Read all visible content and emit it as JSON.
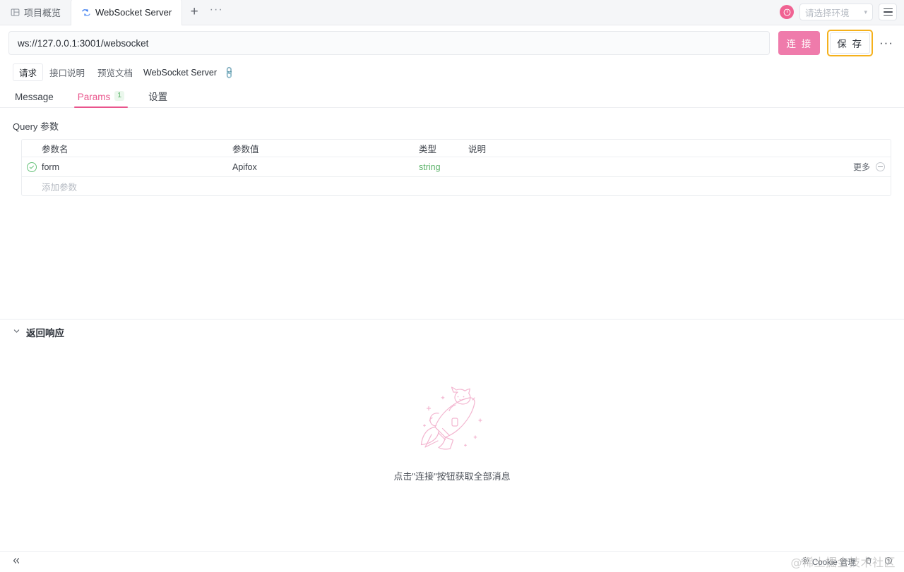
{
  "tabstrip": {
    "tabs": [
      {
        "label": "项目概览",
        "icon": "layout-icon",
        "active": false
      },
      {
        "label": "WebSocket Server",
        "icon": "websocket-icon",
        "active": true
      }
    ],
    "new_tab_label": "+",
    "more_tabs_label": "···",
    "sync_icon": "sync-status-icon",
    "environment_placeholder": "请选择环境",
    "menu_icon": "hamburger-menu-icon"
  },
  "urlbar": {
    "url": "ws://127.0.0.1:3001/websocket",
    "connect_label": "连 接",
    "save_label": "保 存",
    "more_label": "···",
    "save_highlight_color": "#f5b11c",
    "connect_color": "#ef7bab"
  },
  "subtabs": {
    "items": [
      {
        "label": "请求",
        "active": true
      },
      {
        "label": "接口说明",
        "active": false
      },
      {
        "label": "预览文档",
        "active": false
      }
    ],
    "doc_name": "WebSocket Server",
    "link_icon": "link-icon"
  },
  "maintabs": {
    "items": [
      {
        "label": "Message",
        "active": false,
        "count": ""
      },
      {
        "label": "Params",
        "active": true,
        "count": "1"
      },
      {
        "label": "设置",
        "active": false,
        "count": ""
      }
    ],
    "accent_color": "#e9558c"
  },
  "query": {
    "title": "Query 参数",
    "columns": [
      "参数名",
      "参数值",
      "类型",
      "说明"
    ],
    "rows": [
      {
        "enabled": true,
        "name": "form",
        "value": "Apifox",
        "type": "string",
        "desc": "",
        "more_label": "更多",
        "remove_icon": "remove-circle-icon",
        "check_icon": "check-circle-icon"
      }
    ],
    "add_row_placeholder": "添加参数",
    "type_color": "#5cb36a"
  },
  "response": {
    "title": "返回响应",
    "collapse_icon": "chevron-down-icon",
    "empty_illustration": "cat-rocket-illustration",
    "empty_text": "点击\"连接\"按钮获取全部消息"
  },
  "statusbar": {
    "collapse_icon": "double-chevron-left-icon",
    "items": [
      {
        "label": "Cookie 管理",
        "icon": "gear-icon"
      },
      {
        "label": "",
        "icon": "trash-icon"
      },
      {
        "label": "",
        "icon": "help-circle-icon"
      }
    ]
  },
  "watermark": {
    "text": "@稀土掘金技术社区"
  }
}
